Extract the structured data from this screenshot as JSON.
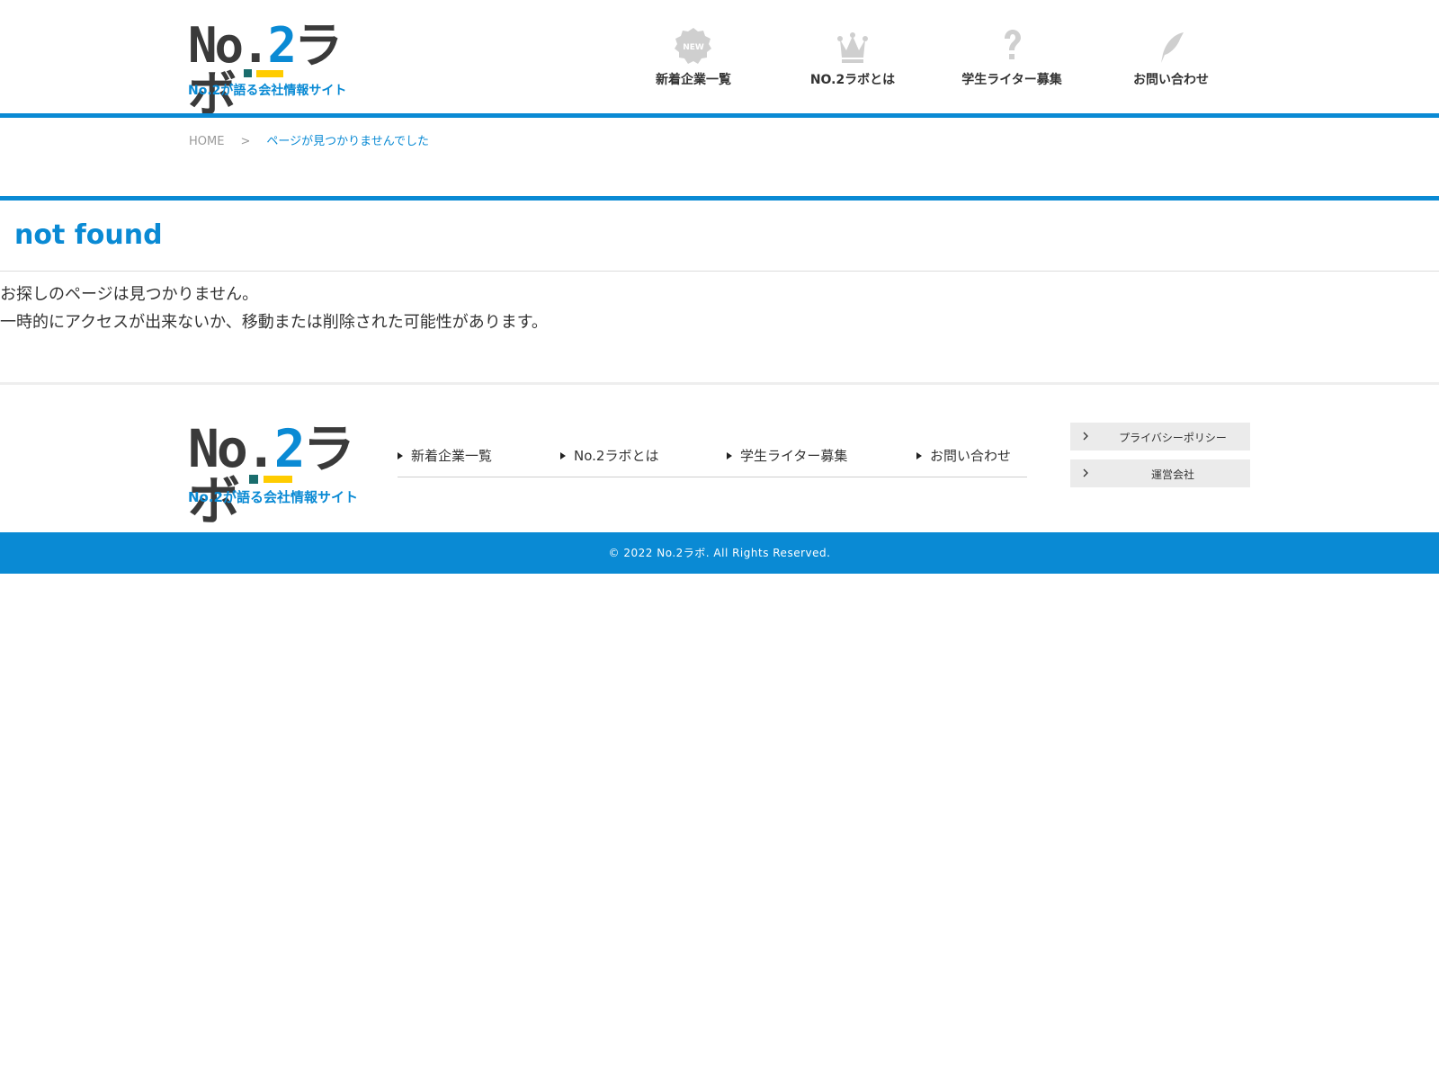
{
  "colors": {
    "accent": "#0a8ad4",
    "yellow": "#ffcc00",
    "icon_gray": "#cfcfcf",
    "text": "#333333"
  },
  "header": {
    "logo": {
      "word_prefix": "No.",
      "word_num": "2",
      "word_suffix": "ラボ",
      "tagline": "No.2が語る会社情報サイト"
    },
    "nav": [
      {
        "label": "新着企業一覧",
        "icon": "new-badge-icon"
      },
      {
        "label": "NO.2ラボとは",
        "icon": "crown-icon"
      },
      {
        "label": "学生ライター募集",
        "icon": "question-mark-icon"
      },
      {
        "label": "お問い合わせ",
        "icon": "feather-pen-icon"
      }
    ]
  },
  "breadcrumb": {
    "home": "HOME",
    "separator": ">",
    "current": "ページが見つかりませんでした"
  },
  "main": {
    "title": "not found",
    "message_line1": "お探しのページは見つかりません。",
    "message_line2": "一時的にアクセスが出来ないか、移動または削除された可能性があります。"
  },
  "footer": {
    "logo": {
      "word_prefix": "No.",
      "word_num": "2",
      "word_suffix": "ラボ",
      "tagline": "No.2が語る会社情報サイト"
    },
    "nav": [
      {
        "label": "新着企業一覧"
      },
      {
        "label": "No.2ラボとは"
      },
      {
        "label": "学生ライター募集"
      },
      {
        "label": "お問い合わせ"
      }
    ],
    "buttons": [
      {
        "label": "プライバシーポリシー",
        "icon": "chevron-right-icon"
      },
      {
        "label": "運営会社",
        "icon": "chevron-right-icon"
      }
    ],
    "copyright": "© 2022 No.2ラボ. All Rights Reserved."
  }
}
